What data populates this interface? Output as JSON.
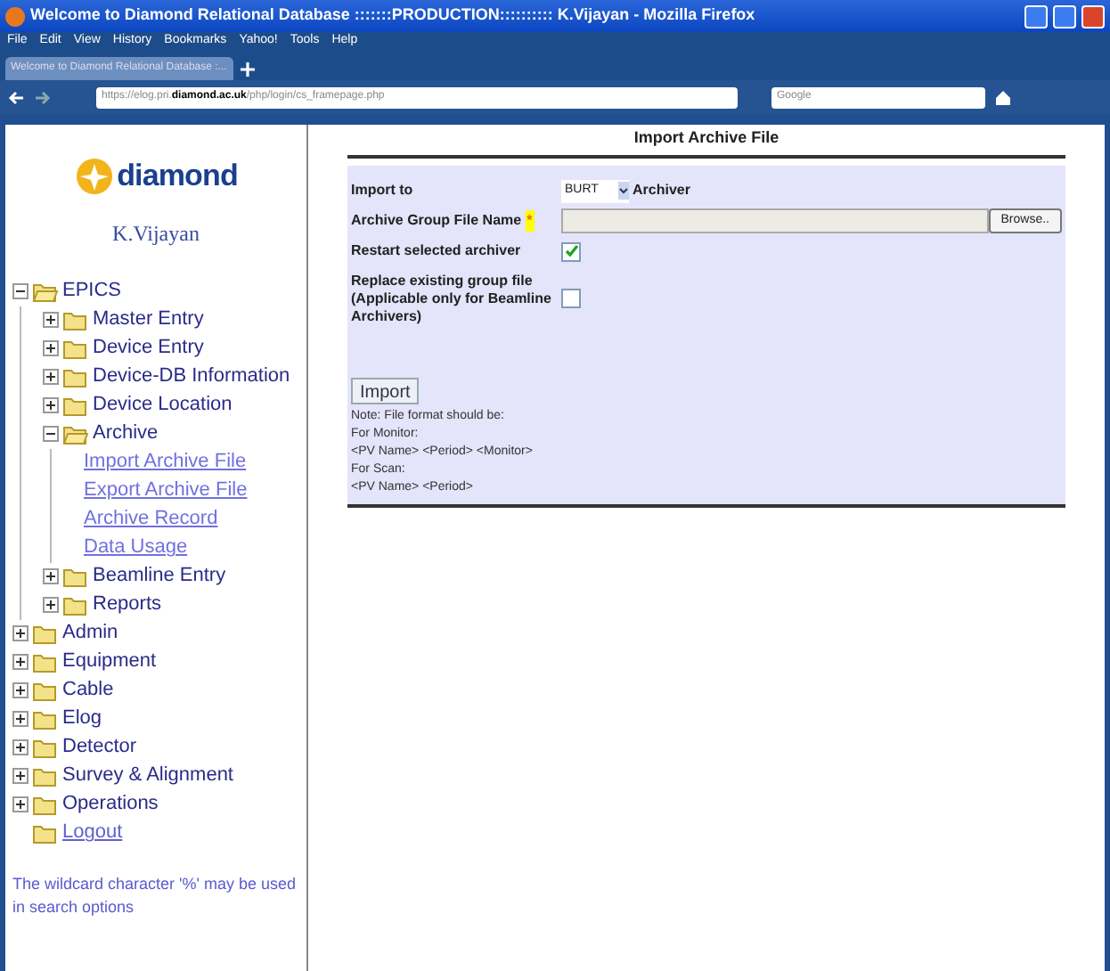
{
  "window": {
    "title": "Welcome to Diamond Relational Database :::::::PRODUCTION:::::::::: K.Vijayan - Mozilla Firefox"
  },
  "menu": [
    "File",
    "Edit",
    "View",
    "History",
    "Bookmarks",
    "Yahoo!",
    "Tools",
    "Help"
  ],
  "tab": {
    "label": "Welcome to Diamond Relational Database :..."
  },
  "address": {
    "prefix": "https://elog.pri.",
    "domain": "diamond.ac.uk",
    "path": "/php/login/cs_framepage.php"
  },
  "search": {
    "placeholder": "Google"
  },
  "sidebar": {
    "logo": "diamond",
    "user": "K.Vijayan",
    "tree": [
      {
        "label": "EPICS",
        "kind": "folder",
        "expanded": true,
        "children": [
          {
            "label": "Master Entry",
            "kind": "folder",
            "expanded": false
          },
          {
            "label": "Device Entry",
            "kind": "folder",
            "expanded": false
          },
          {
            "label": "Device-DB Information",
            "kind": "folder",
            "expanded": false
          },
          {
            "label": "Device Location",
            "kind": "folder",
            "expanded": false
          },
          {
            "label": "Archive",
            "kind": "folder",
            "expanded": true,
            "children": [
              {
                "label": "Import Archive File",
                "kind": "link"
              },
              {
                "label": "Export Archive File",
                "kind": "link"
              },
              {
                "label": "Archive Record",
                "kind": "link"
              },
              {
                "label": "Data Usage",
                "kind": "link"
              }
            ]
          },
          {
            "label": "Beamline Entry",
            "kind": "folder",
            "expanded": false
          },
          {
            "label": "Reports",
            "kind": "folder",
            "expanded": false
          }
        ]
      },
      {
        "label": "Admin",
        "kind": "folder",
        "expanded": false
      },
      {
        "label": "Equipment",
        "kind": "folder",
        "expanded": false
      },
      {
        "label": "Cable",
        "kind": "folder",
        "expanded": false
      },
      {
        "label": "Elog",
        "kind": "folder",
        "expanded": false
      },
      {
        "label": "Detector",
        "kind": "folder",
        "expanded": false
      },
      {
        "label": "Survey & Alignment",
        "kind": "folder",
        "expanded": false
      },
      {
        "label": "Operations",
        "kind": "folder",
        "expanded": false
      },
      {
        "label": "Logout",
        "kind": "logout"
      }
    ],
    "note": "The wildcard character '%' may be used in search options"
  },
  "form": {
    "title": "Import Archive File",
    "import_to": {
      "label": "Import to",
      "value": "BURT",
      "suffix": "Archiver"
    },
    "file": {
      "label": "Archive Group File Name",
      "required": "*",
      "button": "Browse.."
    },
    "restart": {
      "label": "Restart selected archiver",
      "checked": true
    },
    "replace": {
      "label": "Replace existing group file (Applicable only for Beamline Archivers)",
      "checked": false
    },
    "submit": "Import",
    "notes": [
      "Note: File format should be:",
      "For Monitor:",
      "<PV Name> <Period> <Monitor>",
      "For Scan:",
      "<PV Name> <Period>"
    ]
  }
}
